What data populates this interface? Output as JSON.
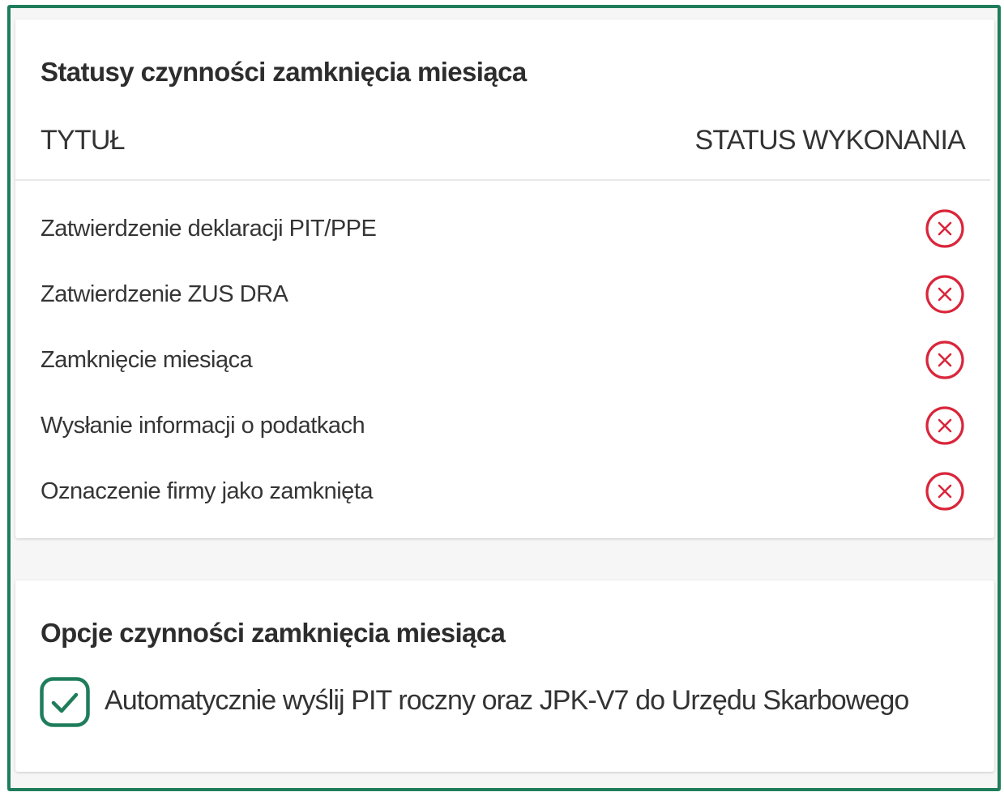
{
  "status_section": {
    "title": "Statusy czynności zamknięcia miesiąca",
    "columns": {
      "title": "TYTUŁ",
      "status": "STATUS WYKONANIA"
    },
    "rows": [
      {
        "label": "Zatwierdzenie deklaracji PIT/PPE",
        "status_icon": "x-circle-icon"
      },
      {
        "label": "Zatwierdzenie ZUS DRA",
        "status_icon": "x-circle-icon"
      },
      {
        "label": "Zamknięcie miesiąca",
        "status_icon": "x-circle-icon"
      },
      {
        "label": "Wysłanie informacji o podatkach",
        "status_icon": "x-circle-icon"
      },
      {
        "label": "Oznaczenie firmy jako zamknięta",
        "status_icon": "x-circle-icon"
      }
    ],
    "status_color": "#d9263b"
  },
  "options_section": {
    "title": "Opcje czynności zamknięcia miesiąca",
    "auto_send": {
      "label": "Automatycznie wyślij PIT roczny oraz JPK-V7 do Urzędu Skarbowego",
      "checked": true
    }
  },
  "colors": {
    "accent": "#1f7d5b",
    "status_not_done": "#d9263b"
  }
}
